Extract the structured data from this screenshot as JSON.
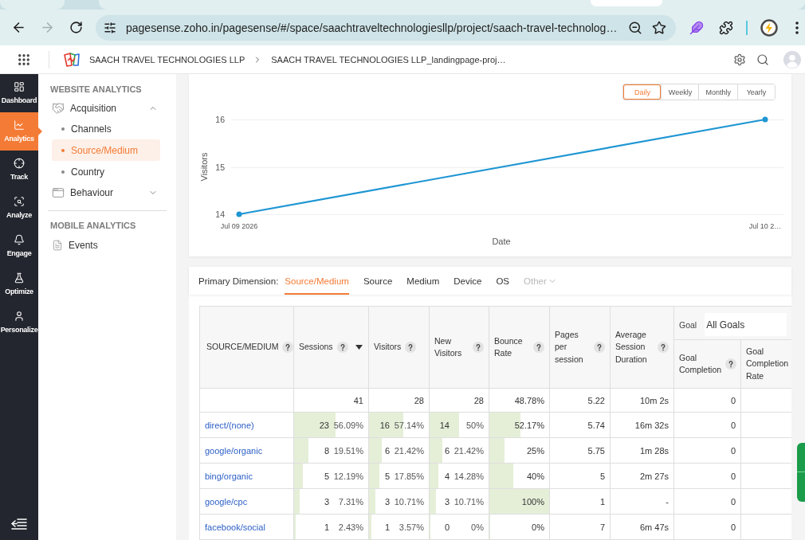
{
  "browser": {
    "history_buttons": [
      {
        "kind": "back",
        "disabled": false
      },
      {
        "kind": "forward",
        "disabled": true
      }
    ],
    "url": "pagesense.zoho.in/pagesense/#/space/saachtraveltechnologiesllp/project/saach-travel-technolog…",
    "bookmarked": false
  },
  "app_header": {
    "breadcrumbs": [
      "SAACH TRAVEL TECHNOLOGIES LLP",
      "SAACH TRAVEL TECHNOLOGIES LLP_landingpage-proj…"
    ]
  },
  "nav": [
    {
      "label": "Dashboard",
      "selected": false
    },
    {
      "label": "Analytics",
      "selected": true
    },
    {
      "label": "Track",
      "selected": false
    },
    {
      "label": "Analyze",
      "selected": false
    },
    {
      "label": "Engage",
      "selected": false
    },
    {
      "label": "Optimize",
      "selected": false
    },
    {
      "label": "Personalize",
      "selected": false
    }
  ],
  "sidebar": {
    "sections": [
      {
        "title": "WEBSITE ANALYTICS",
        "items": [
          {
            "kind": "group",
            "label": "Acquisition",
            "expanded": true,
            "children": [
              {
                "label": "Channels",
                "selected": false
              },
              {
                "label": "Source/Medium",
                "selected": true
              },
              {
                "label": "Country",
                "selected": false
              }
            ]
          },
          {
            "kind": "group",
            "label": "Behaviour",
            "expanded": false
          }
        ]
      },
      {
        "title": "MOBILE ANALYTICS",
        "items": [
          {
            "kind": "link",
            "label": "Events",
            "selected": false
          }
        ]
      }
    ]
  },
  "chart": {
    "period_buttons": [
      {
        "label": "Daily",
        "selected": true
      },
      {
        "label": "Weekly",
        "selected": false
      },
      {
        "label": "Monthly",
        "selected": false
      },
      {
        "label": "Yearly",
        "selected": false
      }
    ],
    "chart_data": {
      "type": "line",
      "xlabel": "Date",
      "ylabel": "Visitors",
      "categories": [
        "Jul 09 2026",
        "Jul 10 2…"
      ],
      "series": [
        {
          "color": "#1f96d3",
          "marker": "o",
          "values": [
            14,
            16
          ]
        }
      ],
      "ylim": [
        14,
        16
      ],
      "yticks": [
        14,
        15,
        16
      ]
    }
  },
  "dimension_bar": {
    "label": "Primary Dimension:",
    "tabs": [
      {
        "kind": "tab",
        "label": "Source/Medium",
        "selected": true,
        "disabled": false
      },
      {
        "kind": "tab",
        "label": "Source",
        "selected": false,
        "disabled": false
      },
      {
        "kind": "tab",
        "label": "Medium",
        "selected": false,
        "disabled": false
      },
      {
        "kind": "tab",
        "label": "Device",
        "selected": false,
        "disabled": false
      },
      {
        "kind": "tab",
        "label": "OS",
        "selected": false,
        "disabled": false
      },
      {
        "kind": "dropdown",
        "label": "Other",
        "selected": false,
        "disabled": true
      }
    ]
  },
  "table": {
    "columns": [
      {
        "label": "SOURCE/MEDIUM",
        "help": true,
        "sorted": false
      },
      {
        "label": "Sessions",
        "help": true,
        "sorted": true
      },
      {
        "label": "Visitors",
        "help": true,
        "sorted": false
      },
      {
        "label": "New Visitors",
        "help": true,
        "sorted": false
      },
      {
        "label": "Bounce Rate",
        "help": true,
        "sorted": false
      },
      {
        "label": "Pages per session",
        "help": true,
        "sorted": false
      },
      {
        "label": "Average Session Duration",
        "help": true,
        "sorted": false
      }
    ],
    "goal_group": {
      "label": "Goal",
      "select": "All Goals",
      "columns": [
        {
          "label": "Goal Completion",
          "help": true
        },
        {
          "label": "Goal Completion Rate",
          "help": false
        }
      ]
    },
    "totals": {
      "sessions": "41",
      "visitors": "28",
      "new_visitors": "28",
      "bounce_rate": "48.78%",
      "pages_per_session": "5.22",
      "avg_session_duration": "10m 2s",
      "goal_completion": "0"
    },
    "rows": [
      {
        "source": "direct/(none)",
        "sessions": {
          "count": "23",
          "share": "56.09%",
          "level": 0.5609
        },
        "visitors": {
          "count": "16",
          "share": "57.14%",
          "level": 0.5714
        },
        "new_visitors": {
          "count": "14",
          "share": "50%",
          "level": 0.5
        },
        "bounce_rate": {
          "value": "52.17%",
          "level": 0.5217
        },
        "pages_per_session": "5.74",
        "avg_session_duration": "16m 32s",
        "goal_completion": "0"
      },
      {
        "source": "google/organic",
        "sessions": {
          "count": "8",
          "share": "19.51%",
          "level": 0.1951
        },
        "visitors": {
          "count": "6",
          "share": "21.42%",
          "level": 0.2142
        },
        "new_visitors": {
          "count": "6",
          "share": "21.42%",
          "level": 0.2142
        },
        "bounce_rate": {
          "value": "25%",
          "level": 0.25
        },
        "pages_per_session": "5.75",
        "avg_session_duration": "1m 28s",
        "goal_completion": "0"
      },
      {
        "source": "bing/organic",
        "sessions": {
          "count": "5",
          "share": "12.19%",
          "level": 0.1219
        },
        "visitors": {
          "count": "5",
          "share": "17.85%",
          "level": 0.1785
        },
        "new_visitors": {
          "count": "4",
          "share": "14.28%",
          "level": 0.1428
        },
        "bounce_rate": {
          "value": "40%",
          "level": 0.4
        },
        "pages_per_session": "5",
        "avg_session_duration": "2m 27s",
        "goal_completion": "0"
      },
      {
        "source": "google/cpc",
        "sessions": {
          "count": "3",
          "share": "7.31%",
          "level": 0.0731
        },
        "visitors": {
          "count": "3",
          "share": "10.71%",
          "level": 0.1071
        },
        "new_visitors": {
          "count": "3",
          "share": "10.71%",
          "level": 0.1071
        },
        "bounce_rate": {
          "value": "100%",
          "level": 1
        },
        "pages_per_session": "1",
        "avg_session_duration": "-",
        "goal_completion": "0"
      },
      {
        "source": "facebook/social",
        "sessions": {
          "count": "1",
          "share": "2.43%",
          "level": 0.0243
        },
        "visitors": {
          "count": "1",
          "share": "3.57%",
          "level": 0.0357
        },
        "new_visitors": {
          "count": "0",
          "share": "0%",
          "level": 0
        },
        "bounce_rate": {
          "value": "0%",
          "level": 0
        },
        "pages_per_session": "7",
        "avg_session_duration": "6m 47s",
        "goal_completion": "0"
      }
    ]
  }
}
